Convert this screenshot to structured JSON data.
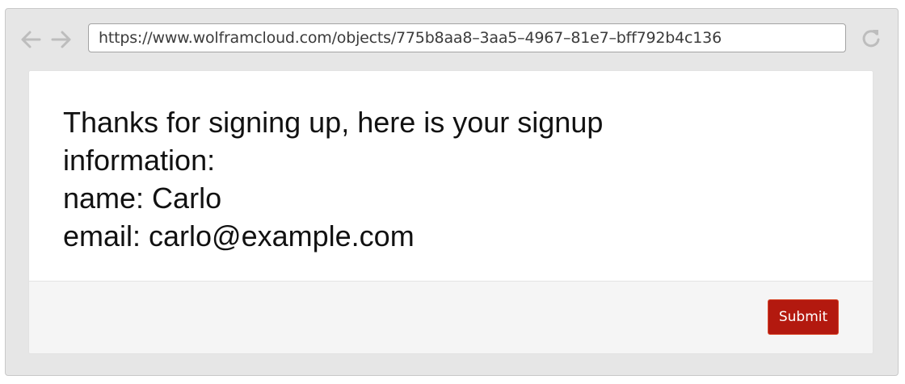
{
  "browser": {
    "url": "https://www.wolframcloud.com/objects/775b8aa8–3aa5–4967–81e7–bff792b4c136",
    "back_icon": "arrow-left-icon",
    "forward_icon": "arrow-right-icon",
    "reload_icon": "reload-icon"
  },
  "page": {
    "message_lines": [
      "Thanks for signing up, here is your signup",
      "information:",
      "name: Carlo",
      "email: carlo@example.com"
    ],
    "submit_label": "Submit"
  },
  "colors": {
    "submit_bg": "#b3190f",
    "footer_bg": "#f5f5f5",
    "chrome_bg": "#e6e6e6"
  }
}
